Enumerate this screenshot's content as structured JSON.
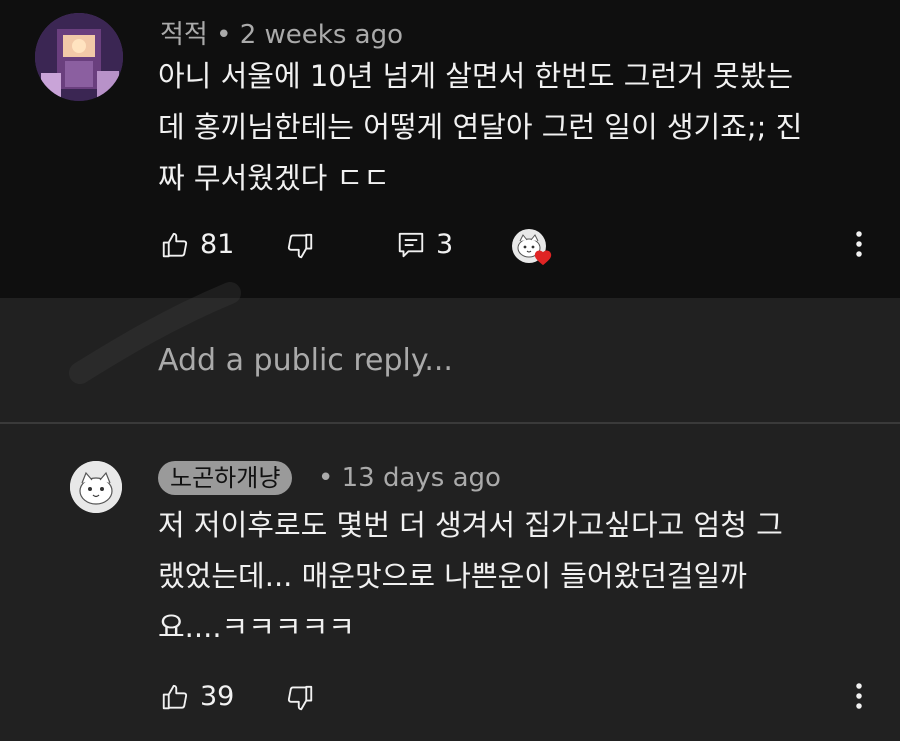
{
  "comment1": {
    "author": "적적",
    "time": "2 weeks ago",
    "text_lines": [
      "아니 서울에 10년 넘게 살면서 한번도 그런거 못봤는",
      "데 홍끼님한테는 어떻게 연달아 그런 일이 생기죠;; 진",
      "짜 무서웠겠다 ㄷㄷ"
    ],
    "likes": "81",
    "replies": "3"
  },
  "reply_box": {
    "placeholder": "Add a public reply..."
  },
  "comment2": {
    "author": "노곤하개냥",
    "time": "13 days ago",
    "text_lines": [
      "저 저이후로도 몇번 더 생겨서 집가고싶다고 엄청 그",
      "랬었는데... 매운맛으로 나쁜운이 들어왔던걸일까",
      "요....ㅋㅋㅋㅋㅋ"
    ],
    "likes": "39"
  },
  "separator": "•",
  "icons": {
    "like": "thumbs-up-icon",
    "dislike": "thumbs-down-icon",
    "reply": "reply-icon",
    "more": "more-vert-icon",
    "heart": "heart-icon"
  },
  "colors": {
    "background": "#0f0f0f",
    "reply_panel": "#212121",
    "meta_text": "#aaaaaa",
    "heart": "#e02424"
  }
}
